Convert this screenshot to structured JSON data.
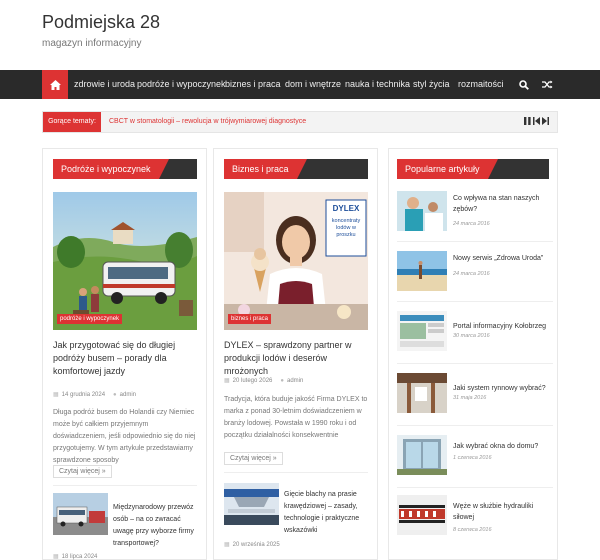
{
  "site": {
    "title": "Podmiejska 28",
    "description": "magazyn informacyjny"
  },
  "nav": {
    "items": [
      "zdrowie i uroda",
      "podróże i wypoczynek",
      "biznes i praca",
      "dom i wnętrze",
      "nauka i technika",
      "styl życia",
      "rozmaitości"
    ],
    "icons": [
      "home-icon",
      "search-icon",
      "shuffle-icon"
    ]
  },
  "ticker": {
    "label": "Gorące tematy:",
    "text": "CBCT w stomatologii – rewolucja w trójwymiarowej diagnostyce"
  },
  "col1": {
    "heading": "Podróże i wypoczynek",
    "badge": "podróże i wypoczynek",
    "title": "Jak przygotować się do długiej podróży busem – porady dla komfortowej jazdy",
    "date": "14 grudnia 2024",
    "author": "admin",
    "excerpt": "Długa podróż busem do Holandii czy Niemiec może być całkiem przyjemnym doświadczeniem, jeśli odpowiednio się do niej przygotujemy. W tym artykule przedstawiamy sprawdzone sposoby",
    "more": "Czytaj więcej »",
    "small_title": "Międzynarodowy przewóz osób – na co zwracać uwagę przy wyborze firmy transportowej?",
    "small_date": "18 lipca 2024"
  },
  "col2": {
    "heading": "Biznes i praca",
    "badge": "biznes i praca",
    "img_brand": "DYLEX",
    "img_caption": "koncentraty lodów w proszku",
    "title": "DYLEX – sprawdzony partner w produkcji lodów i deserów mrożonych",
    "date": "20 lutego 2026",
    "author": "admin",
    "excerpt": "Tradycja, która buduje jakość Firma DYLEX to marka z ponad 30-letnim doświadczeniem w branży lodowej. Powstała w 1990 roku i od początku działalności konsekwentnie",
    "more": "Czytaj więcej »",
    "small_title": "Gięcie blachy na prasie krawędziowej – zasady, technologie i praktyczne wskazówki",
    "small_date": "20 września 2025"
  },
  "sidebar": {
    "heading": "Popularne artykuły",
    "items": [
      {
        "title": "Co wpływa na stan naszych zębów?",
        "date": "24 marca 2016"
      },
      {
        "title": "Nowy serwis „Zdrowa Uroda”",
        "date": "24 marca 2016"
      },
      {
        "title": "Portal informacyjny Kołobrzeg",
        "date": "30 marca 2016"
      },
      {
        "title": "Jaki system rynnowy wybrać?",
        "date": "31 maja 2016"
      },
      {
        "title": "Jak wybrać okna do domu?",
        "date": "1 czerwca 2016"
      },
      {
        "title": "Węże w służbie hydrauliki siłowej",
        "date": "8 czerwca 2016"
      }
    ]
  }
}
